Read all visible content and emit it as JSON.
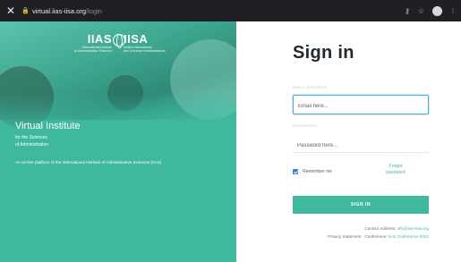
{
  "browser": {
    "close_glyph": "✕",
    "lock_icon": "lock-icon",
    "url_host": "virtual.iias-iisa.org",
    "url_path": "/login",
    "key_glyph": "⚷",
    "star_glyph": "☆",
    "more_glyph": "⋮"
  },
  "left_panel": {
    "background": "#3fb8a0",
    "logo": {
      "left_big": "IIAS",
      "left_small_1": "International Institute",
      "left_small_2": "of Administrative Sciences",
      "right_big": "IISA",
      "right_small_1": "Institut International",
      "right_small_2": "des Sciences Administratives"
    },
    "title": "Virtual Institute",
    "subtitle_1": "for the Sciences",
    "subtitle_2": "of Administration",
    "description": "An on-line platform of the International Institute of Administrative Sciences (IIAS)"
  },
  "form": {
    "title": "Sign in",
    "email_label": "EMAIL ADDRESS",
    "email_placeholder": "Email here...",
    "email_value": "",
    "password_label": "PASSWORD*",
    "password_placeholder": "Password here...",
    "password_value": "",
    "remember_label": "Remember me",
    "remember_checked": true,
    "forgot_1": "Forgot",
    "forgot_2": "password",
    "submit_label": "SIGN IN",
    "accent": "#3fb8a0"
  },
  "footer": {
    "contact_prefix": "Contact Address: ",
    "contact_link": "info@iias-iisa.org",
    "privacy_prefix": "Privacy Statement · Conference: ",
    "privacy_link": "IIAS Conference 2021"
  }
}
